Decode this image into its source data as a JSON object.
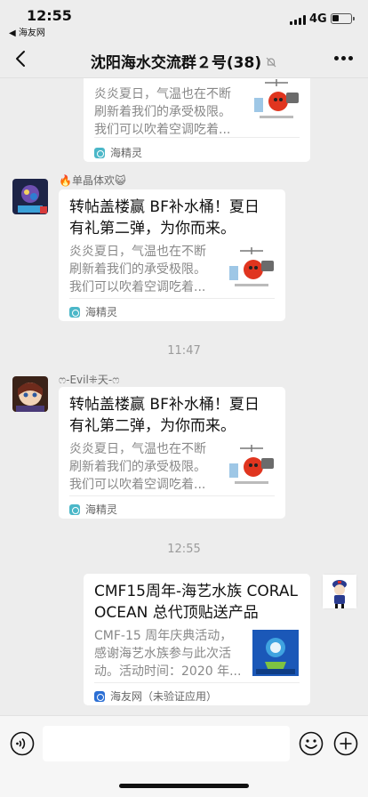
{
  "status_bar": {
    "time": "12:55",
    "back_app": "◀ 海友网",
    "network": "4G"
  },
  "nav": {
    "title": "沈阳海水交流群２号(38)"
  },
  "messages": [
    {
      "card": {
        "desc_line1": "炎炎夏日，气温也在不断",
        "desc_line2": "刷新着我们的承受极限。",
        "desc_line3": "我们可以吹着空调吃着...",
        "source": "海精灵"
      }
    },
    {
      "sender": "🔥单晶体欢😺",
      "card": {
        "title_line1": "转帖盖楼赢 BF补水桶！夏日",
        "title_line2": "有礼第二弹，为你而来。",
        "desc_line1": "炎炎夏日，气温也在不断",
        "desc_line2": "刷新着我们的承受极限。",
        "desc_line3": "我们可以吹着空调吃着...",
        "source": "海精灵"
      }
    },
    {
      "timestamp": "11:47"
    },
    {
      "sender": "ෆ-Evil⁜天-ෆ",
      "card": {
        "title_line1": "转帖盖楼赢 BF补水桶！夏日",
        "title_line2": "有礼第二弹，为你而来。",
        "desc_line1": "炎炎夏日，气温也在不断",
        "desc_line2": "刷新着我们的承受极限。",
        "desc_line3": "我们可以吹着空调吃着...",
        "source": "海精灵"
      }
    },
    {
      "timestamp": "12:55"
    },
    {
      "card": {
        "title_line1": "CMF15周年-海艺水族 CORAL",
        "title_line2": "OCEAN 总代顶贴送产品",
        "desc_line1": "CMF-15 周年庆典活动，",
        "desc_line2": "感谢海艺水族参与此次活",
        "desc_line3": "动。活动时间：2020 年...",
        "source": "海友网（未验证应用）"
      }
    }
  ],
  "icons": {
    "back": "chevron-left-icon",
    "mute": "bell-slash-icon",
    "more": "more-dots-icon",
    "voice": "voice-icon",
    "emoji": "emoji-icon",
    "plus": "plus-circle-icon"
  }
}
